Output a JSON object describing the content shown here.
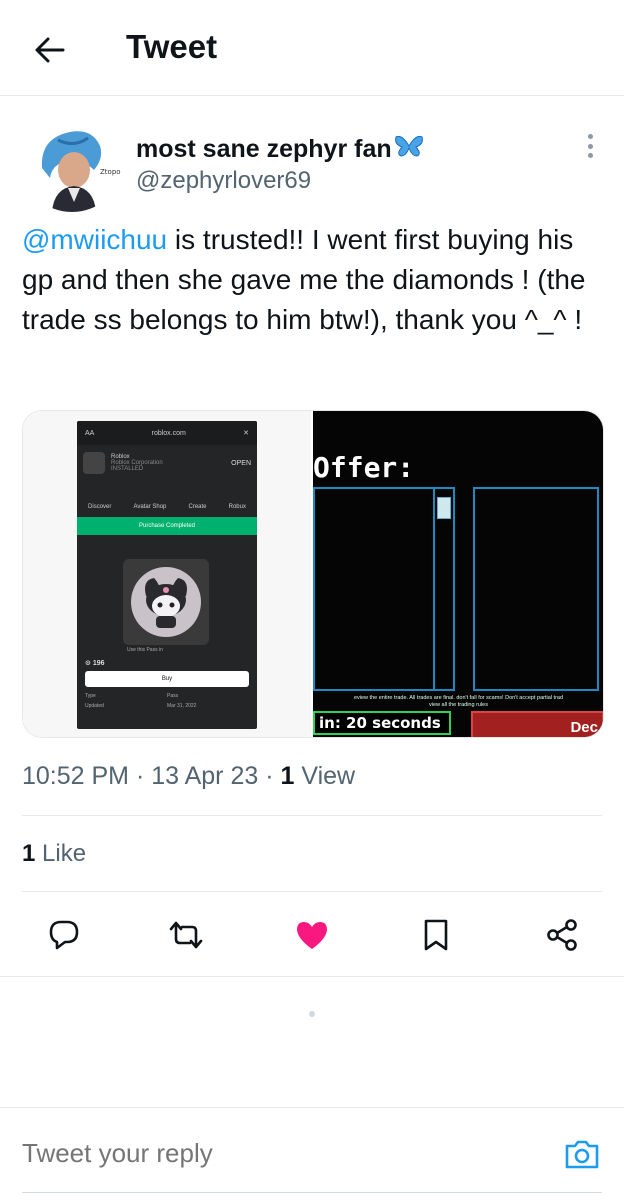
{
  "header": {
    "title": "Tweet"
  },
  "author": {
    "display_name": "most sane zephyr fan",
    "name_emoji": "🦋",
    "handle": "@zephyrlover69"
  },
  "tweet": {
    "mention": "@mwiichuu",
    "text": " is trusted!! I went first buying his gp and then she gave me the diamonds ! (the trade ss belongs to him btw!), thank you ^_^ !"
  },
  "media": {
    "left": {
      "url": "roblox.com",
      "app_name": "Roblox",
      "app_publisher": "Roblox Corporation",
      "app_status": "INSTALLED",
      "open_label": "OPEN",
      "nav": [
        "Discover",
        "Avatar Shop",
        "Create",
        "Robux"
      ],
      "banner": "Purchase Completed",
      "use_pass": "Use this Pass in",
      "price": "196",
      "buy_label": "Buy",
      "type_label": "Type",
      "type_value": "Pass",
      "updated_label": "Updated",
      "updated_value": "Mar 31, 2022"
    },
    "right": {
      "title": "Offer:",
      "warning": "eview the entire trade. All trades are final. don't fall for scams! Don't accept partial trad",
      "warning2": "view all the trading rules",
      "timer": "in: 20 seconds",
      "decline": "Dec"
    }
  },
  "meta": {
    "time": "10:52 PM",
    "date": "13 Apr 23",
    "views_count": "1",
    "views_label": "View"
  },
  "likes": {
    "count": "1",
    "label": "Like"
  },
  "actions": {
    "reply": "reply-icon",
    "retweet": "retweet-icon",
    "like": "heart-icon",
    "bookmark": "bookmark-icon",
    "share": "share-icon"
  },
  "reply": {
    "placeholder": "Tweet your reply"
  },
  "colors": {
    "accent": "#1d9bf0",
    "like": "#f91880",
    "text": "#0f1419",
    "secondary": "#536471"
  }
}
